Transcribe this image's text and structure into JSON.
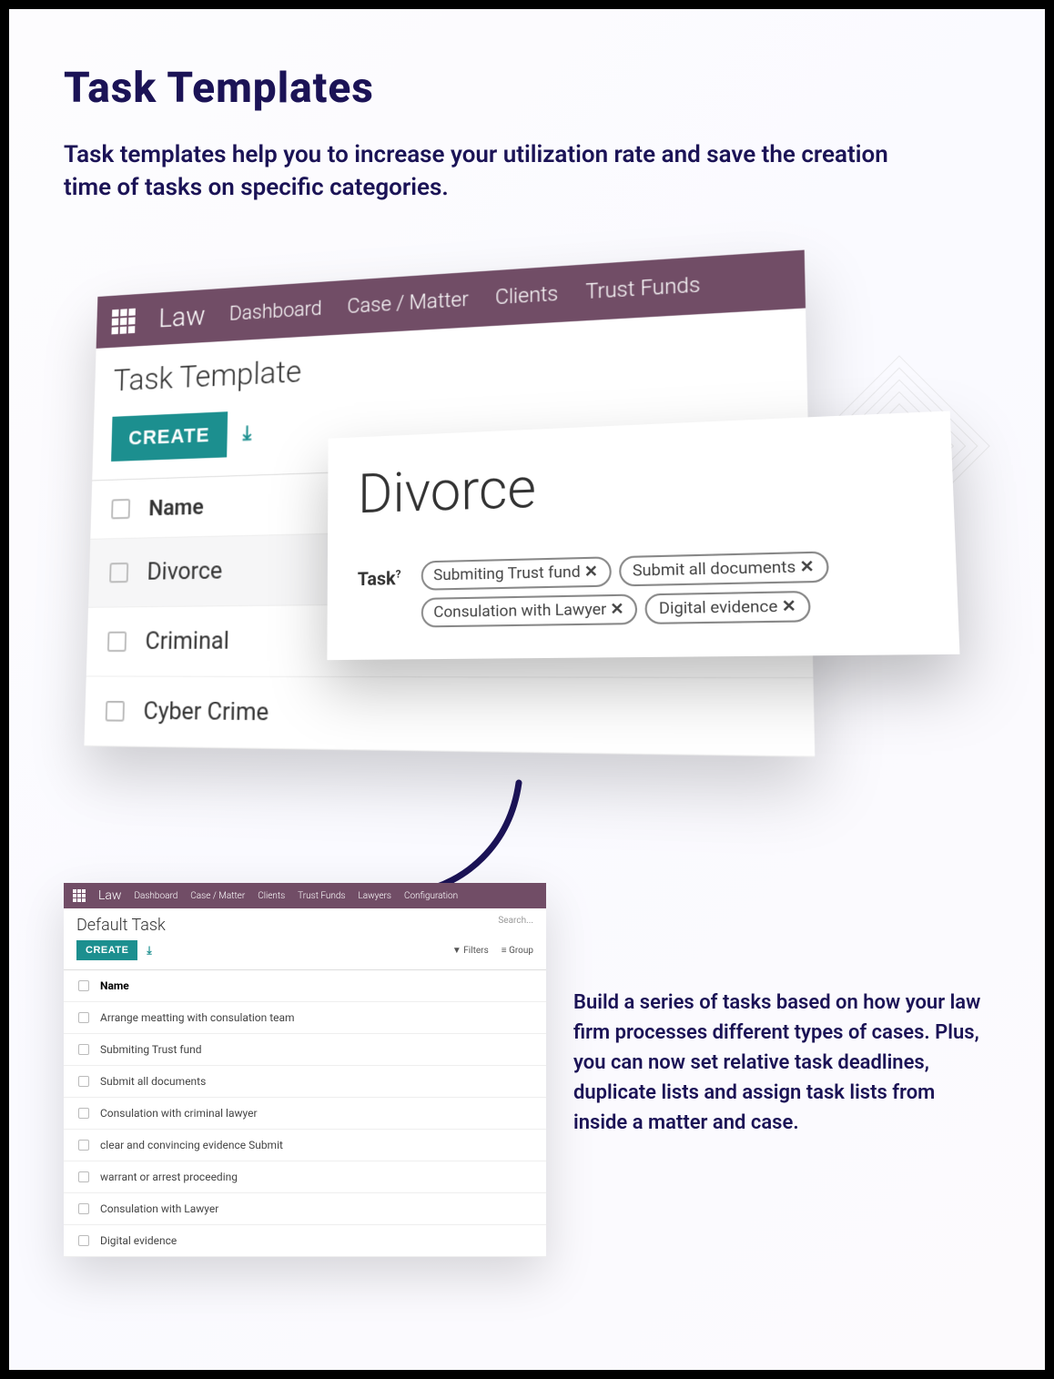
{
  "heading": "Task Templates",
  "subheading": "Task templates help you to increase your utilization rate and save the creation time of tasks on specific categories.",
  "main_shot": {
    "app_name": "Law",
    "nav": [
      "Dashboard",
      "Case / Matter",
      "Clients",
      "Trust Funds"
    ],
    "module_title": "Task Template",
    "create_label": "CREATE",
    "col_name": "Name",
    "rows": [
      "Divorce",
      "Criminal",
      "Cyber Crime"
    ]
  },
  "detail": {
    "title": "Divorce",
    "task_label": "Task",
    "tags": [
      "Submiting Trust fund",
      "Submit all documents",
      "Consulation with Lawyer",
      "Digital evidence"
    ]
  },
  "small_shot": {
    "app_name": "Law",
    "nav": [
      "Dashboard",
      "Case / Matter",
      "Clients",
      "Trust Funds",
      "Lawyers",
      "Configuration"
    ],
    "module_title": "Default Task",
    "create_label": "CREATE",
    "search_placeholder": "Search...",
    "filters_label": "Filters",
    "group_label": "Group",
    "col_name": "Name",
    "rows": [
      "Arrange meatting with consulation team",
      "Submiting Trust fund",
      "Submit all documents",
      "Consulation with criminal lawyer",
      "clear and convincing evidence Submit",
      "warrant or arrest proceeding",
      "Consulation with Lawyer",
      "Digital evidence"
    ]
  },
  "body_text": "Build a series of tasks based on how your law firm processes different types of cases. Plus, you can now set relative task deadlines, duplicate lists and assign task lists from inside a matter and case."
}
